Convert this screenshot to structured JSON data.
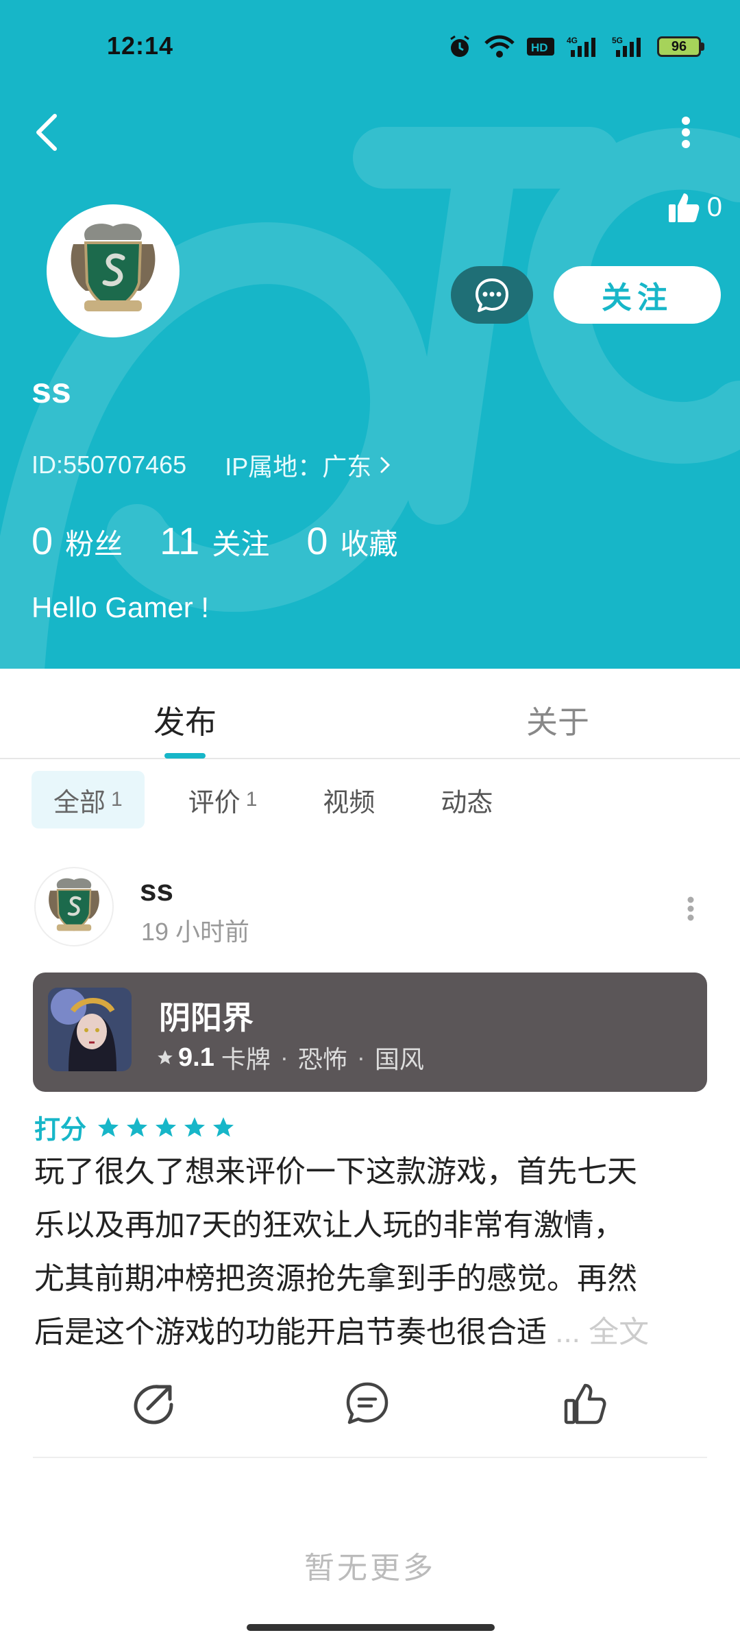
{
  "status_bar": {
    "time": "12:14",
    "icons": [
      "alarm-icon",
      "wifi-icon",
      "hd-icon",
      "signal-4g-icon",
      "signal-5g-icon"
    ],
    "battery": "96"
  },
  "header": {
    "like_count": "0",
    "follow_label": "关注",
    "username": "ss",
    "id_text": "ID:550707465",
    "ip_text": "IP属地：广东",
    "stats": [
      {
        "num": "0",
        "label": "粉丝"
      },
      {
        "num": "11",
        "label": "关注"
      },
      {
        "num": "0",
        "label": "收藏"
      }
    ],
    "bio": "Hello Gamer !"
  },
  "tabs": [
    {
      "label": "发布",
      "active": true
    },
    {
      "label": "关于",
      "active": false
    }
  ],
  "filters": [
    {
      "label": "全部",
      "count": "1",
      "active": true
    },
    {
      "label": "评价",
      "count": "1",
      "active": false
    },
    {
      "label": "视频",
      "count": "",
      "active": false
    },
    {
      "label": "动态",
      "count": "",
      "active": false
    }
  ],
  "post": {
    "author": "ss",
    "time": "19 小时前",
    "game": {
      "name": "阴阳界",
      "score": "9.1",
      "tags": [
        "卡牌",
        "恐怖",
        "国风"
      ]
    },
    "rating_label": "打分",
    "rating": 5,
    "text_lines": [
      "玩了很久了想来评价一下这款游戏，首先七天",
      "乐以及再加7天的狂欢让人玩的非常有激情，",
      "尤其前期冲榜把资源抢先拿到手的感觉。再然",
      "后是这个游戏的功能开启节奏也很合适"
    ],
    "more_link": "... 全文"
  },
  "footer": {
    "no_more": "暂无更多"
  },
  "colors": {
    "brand": "#17b6c8",
    "message_button": "#1f6f76",
    "game_card": "#5b5658"
  }
}
